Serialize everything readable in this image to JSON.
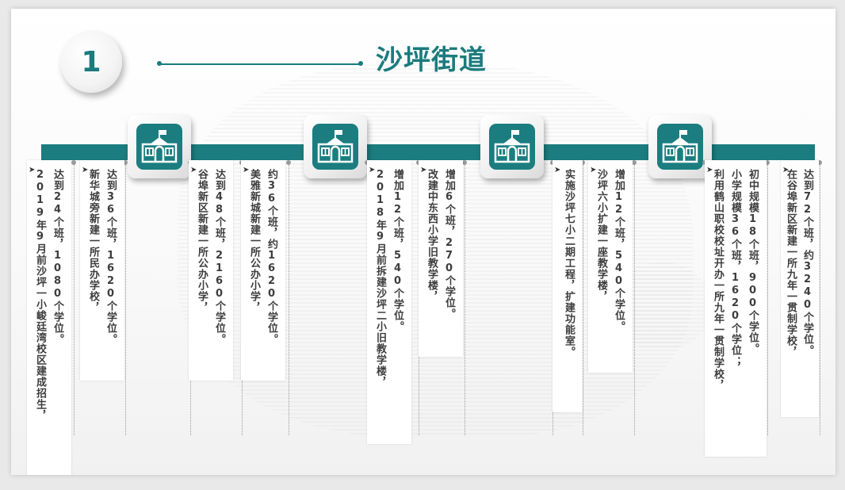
{
  "header": {
    "number": "1",
    "title": "沙坪街道"
  },
  "colors": {
    "accent": "#1b7b7d",
    "band": "#1b7d80",
    "text": "#3d3d3d"
  },
  "icons": [
    "school-building-icon",
    "school-building-icon",
    "school-building-icon",
    "school-building-icon"
  ],
  "bullet_glyph": "➤",
  "items": [
    {
      "lines": [
        "达到24个班，1080个学位。",
        "2019年9月前沙坪一小峻廷湾校区建成招生，"
      ]
    },
    {
      "lines": [
        "达到36个班，1620个学位。",
        "新华城旁新建一所民办学校，"
      ]
    },
    {
      "lines": [
        "达到48个班，2160个学位。",
        "谷埠新区新建一所公办小学，"
      ]
    },
    {
      "lines": [
        "约36个班，约1620个学位。",
        "美雅新城新建一所公办小学，"
      ]
    },
    {
      "lines": [
        "增加12个班，540个学位。",
        "2018年9月前拆建沙坪二小旧教学楼，"
      ]
    },
    {
      "lines": [
        "增加6个班，270个学位。",
        "改建中东西小学旧教学楼，"
      ]
    },
    {
      "lines": [
        "实施沙坪七小二期工程，扩建功能室。"
      ]
    },
    {
      "lines": [
        "增加12个班，540个学位。",
        "沙坪六小扩建一座教学楼，"
      ]
    },
    {
      "lines": [
        "初中规模18个班，900个学位。",
        "小学规模36个班，1620个学位；",
        "利用鹤山职校校址开办一所九年一贯制学校，"
      ]
    },
    {
      "lines": [
        "达到72个班，约3240个学位。",
        "在谷埠新区新建一所九年一贯制学校，"
      ]
    }
  ]
}
